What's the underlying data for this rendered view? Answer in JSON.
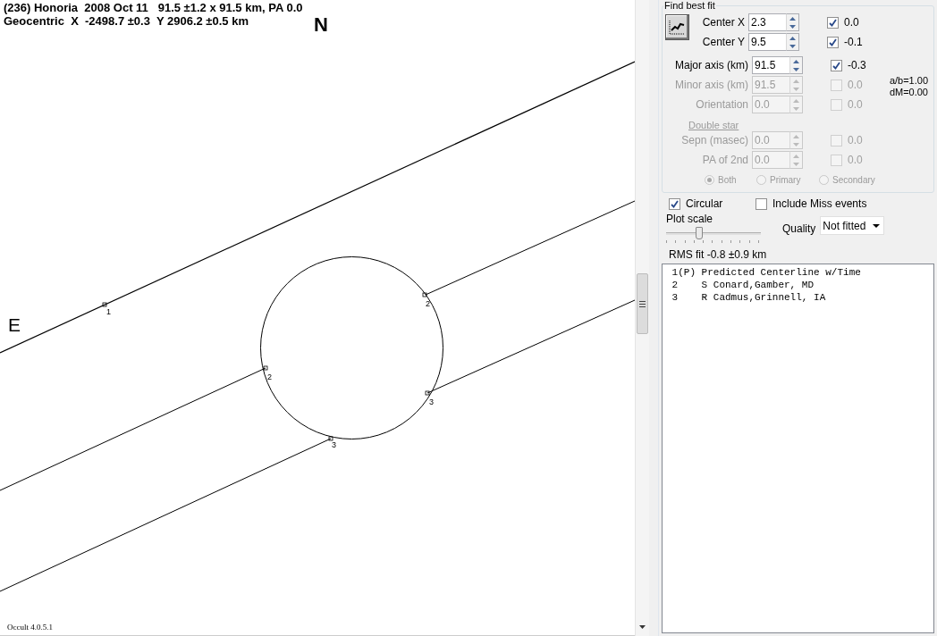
{
  "plot": {
    "title_lines": [
      "(236) Honoria  2008 Oct 11   91.5 ±1.2 x 91.5 km, PA 0.0",
      "Geocentric  X  -2498.7 ±0.3  Y 2906.2 ±0.5 km"
    ],
    "north": "N",
    "east": "E",
    "markers": [
      {
        "label": "1"
      },
      {
        "label": "2"
      },
      {
        "label": "2"
      },
      {
        "label": "3"
      },
      {
        "label": "3"
      }
    ],
    "version": "Occult 4.0.5.1"
  },
  "fit": {
    "group_title": "Find best fit",
    "params": [
      {
        "label": "Center X",
        "value": "2.3",
        "enabled": true,
        "checked": true,
        "residual": "0.0"
      },
      {
        "label": "Center Y",
        "value": "9.5",
        "enabled": true,
        "checked": true,
        "residual": "-0.1"
      },
      {
        "label": "Major axis (km)",
        "value": "91.5",
        "enabled": true,
        "checked": true,
        "residual": "-0.3"
      },
      {
        "label": "Minor axis (km)",
        "value": "91.5",
        "enabled": false,
        "checked": false,
        "residual": "0.0"
      },
      {
        "label": "Orientation",
        "value": "0.0",
        "enabled": false,
        "checked": false,
        "residual": "0.0"
      }
    ],
    "ratio_lines": [
      "a/b=1.00",
      "dM=0.00"
    ],
    "double_star": {
      "label": "Double star",
      "params": [
        {
          "label": "Sepn (masec)",
          "value": "0.0",
          "enabled": false,
          "checked": false,
          "residual": "0.0"
        },
        {
          "label": "PA of 2nd",
          "value": "0.0",
          "enabled": false,
          "checked": false,
          "residual": "0.0"
        }
      ],
      "radios": [
        {
          "label": "Both",
          "selected": true
        },
        {
          "label": "Primary",
          "selected": false
        },
        {
          "label": "Secondary",
          "selected": false
        }
      ]
    },
    "circular": {
      "label": "Circular",
      "checked": true
    },
    "include_miss": {
      "label": "Include Miss events",
      "checked": false
    },
    "plot_scale": {
      "label": "Plot scale",
      "level": 0.33
    },
    "quality": {
      "label": "Quality",
      "value": "Not fitted"
    },
    "rms": "RMS fit -0.8 ±0.9 km",
    "events": [
      " 1(P) Predicted Centerline w/Time",
      " 2    S Conard,Gamber, MD",
      " 3    R Cadmus,Grinnell, IA"
    ]
  }
}
